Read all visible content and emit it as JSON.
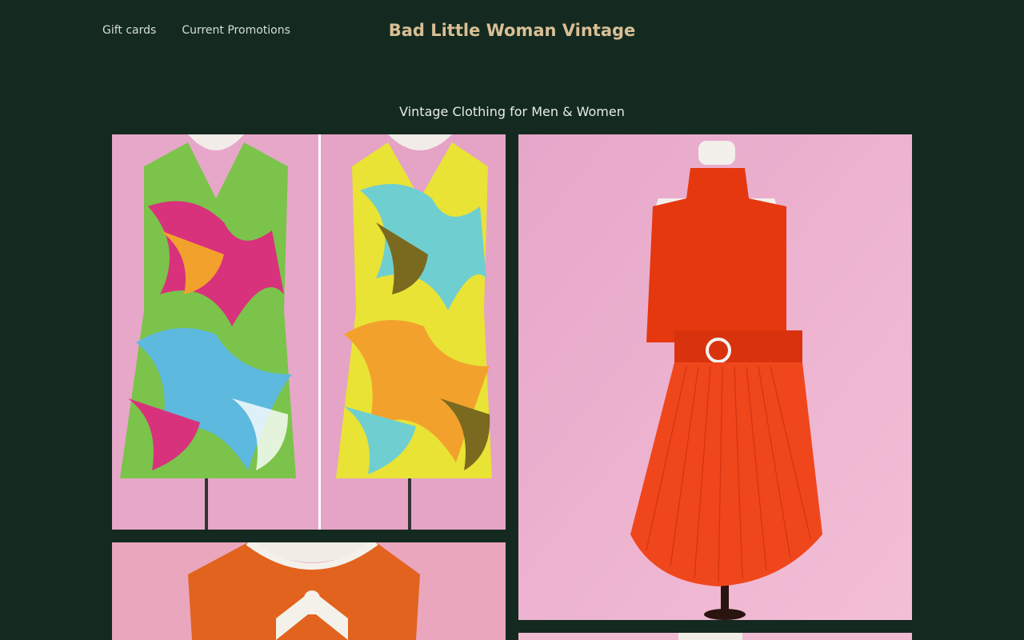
{
  "header": {
    "nav": [
      {
        "label": "Gift cards"
      },
      {
        "label": "Current Promotions"
      }
    ],
    "brand": "Bad Little Woman Vintage"
  },
  "collection": {
    "tagline": "Vintage Clothing for Men & Women"
  },
  "colors": {
    "background": "#142a20",
    "brand": "#d9bf95",
    "photo_backdrop": "#e9a9c4"
  }
}
